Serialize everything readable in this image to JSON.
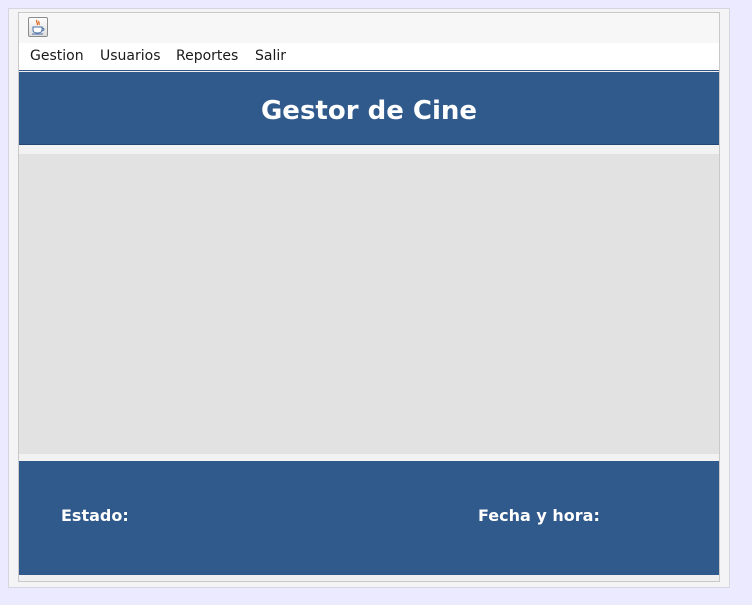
{
  "window": {
    "icon": "java-coffee-icon"
  },
  "menubar": {
    "items": [
      {
        "label": "Gestion"
      },
      {
        "label": "Usuarios"
      },
      {
        "label": "Reportes"
      },
      {
        "label": "Salir"
      }
    ]
  },
  "header": {
    "title": "Gestor de Cine"
  },
  "status": {
    "estado_label": "Estado:",
    "fecha_label": "Fecha y hora:"
  },
  "colors": {
    "panel_blue": "#30598c",
    "content_gray": "#e2e2e2"
  }
}
